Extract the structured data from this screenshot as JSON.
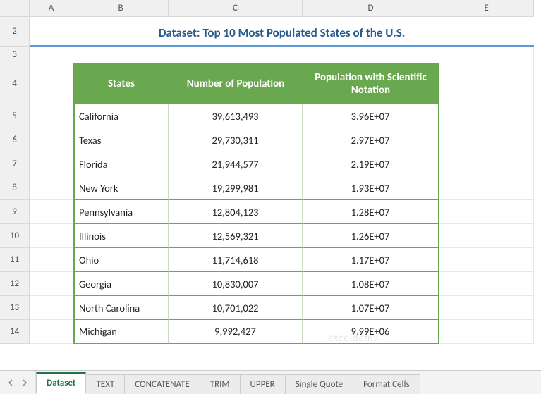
{
  "cols": [
    "A",
    "B",
    "C",
    "D",
    "E"
  ],
  "rows": [
    "2",
    "3",
    "4",
    "5",
    "6",
    "7",
    "8",
    "9",
    "10",
    "11",
    "12",
    "13",
    "14"
  ],
  "title": "Dataset: Top 10 Most Populated States of the U.S.",
  "headers": {
    "state": "States",
    "pop": "Number of Population",
    "sci": "Population with Scientific Notation"
  },
  "data": [
    {
      "state": "California",
      "pop": "39,613,493",
      "sci": "3.96E+07"
    },
    {
      "state": "Texas",
      "pop": "29,730,311",
      "sci": "2.97E+07"
    },
    {
      "state": "Florida",
      "pop": "21,944,577",
      "sci": "2.19E+07"
    },
    {
      "state": "New York",
      "pop": "19,299,981",
      "sci": "1.93E+07"
    },
    {
      "state": "Pennsylvania",
      "pop": "12,804,123",
      "sci": "1.28E+07"
    },
    {
      "state": "Illinois",
      "pop": "12,569,321",
      "sci": "1.26E+07"
    },
    {
      "state": "Ohio",
      "pop": "11,714,618",
      "sci": "1.17E+07"
    },
    {
      "state": "Georgia",
      "pop": "10,830,007",
      "sci": "1.08E+07"
    },
    {
      "state": "North Carolina",
      "pop": "10,701,022",
      "sci": "1.07E+07"
    },
    {
      "state": "Michigan",
      "pop": "9,992,427",
      "sci": "9.99E+06"
    }
  ],
  "tabs": [
    "Dataset",
    "TEXT",
    "CONCATENATE",
    "TRIM",
    "UPPER",
    "Single Quote",
    "Format Cells"
  ],
  "active_tab": "Dataset",
  "watermark": "exceldemy"
}
